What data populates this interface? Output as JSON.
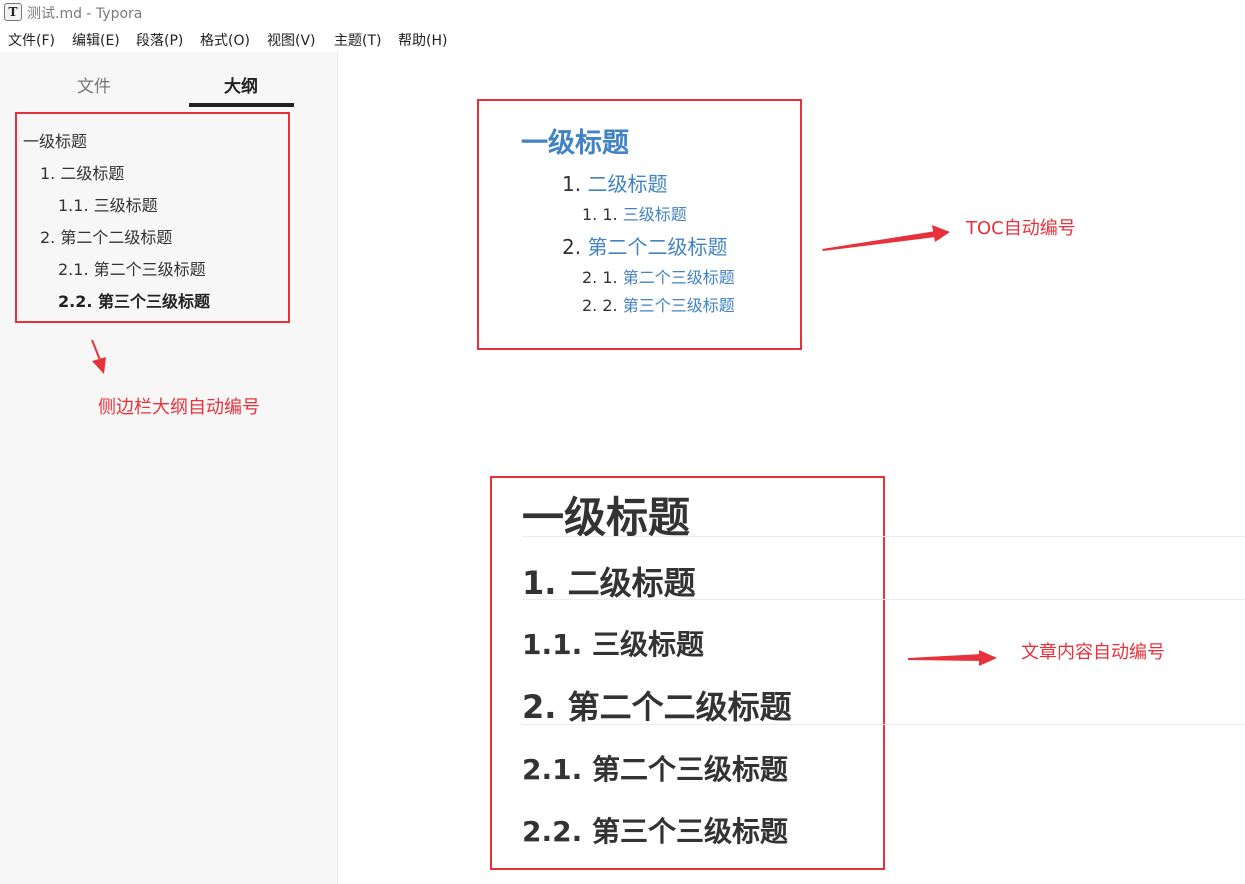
{
  "window": {
    "app_icon": "T",
    "title": "测试.md - Typora"
  },
  "menu": [
    "文件(F)",
    "编辑(E)",
    "段落(P)",
    "格式(O)",
    "视图(V)",
    "主题(T)",
    "帮助(H)"
  ],
  "sidebar": {
    "tabs": [
      "文件",
      "大纲"
    ],
    "active_tab": "大纲",
    "outline": [
      "一级标题",
      "1. 二级标题",
      "1.1. 三级标题",
      "2. 第二个二级标题",
      "2.1. 第二个三级标题",
      "2.2. 第三个三级标题"
    ],
    "active_outline_index": 5
  },
  "annotations": {
    "sidebar": "侧边栏大纲自动编号",
    "toc": "TOC自动编号",
    "content": "文章内容自动编号"
  },
  "toc": {
    "h1": "一级标题",
    "items": [
      {
        "num": "1. ",
        "text": "二级标题"
      },
      {
        "num": "1. 1. ",
        "text": "三级标题"
      },
      {
        "num": "2. ",
        "text": "第二个二级标题"
      },
      {
        "num": "2. 1. ",
        "text": "第二个三级标题"
      },
      {
        "num": "2. 2. ",
        "text": "第三个三级标题"
      }
    ]
  },
  "content": {
    "headings": [
      "一级标题",
      "1. 二级标题",
      "1.1. 三级标题",
      "2. 第二个二级标题",
      "2.1. 第二个三级标题",
      "2.2. 第三个三级标题"
    ]
  },
  "colors": {
    "annotation_red": "#e8323b",
    "toc_link": "#4183c4",
    "sidebar_bg": "#f7f7f7"
  }
}
